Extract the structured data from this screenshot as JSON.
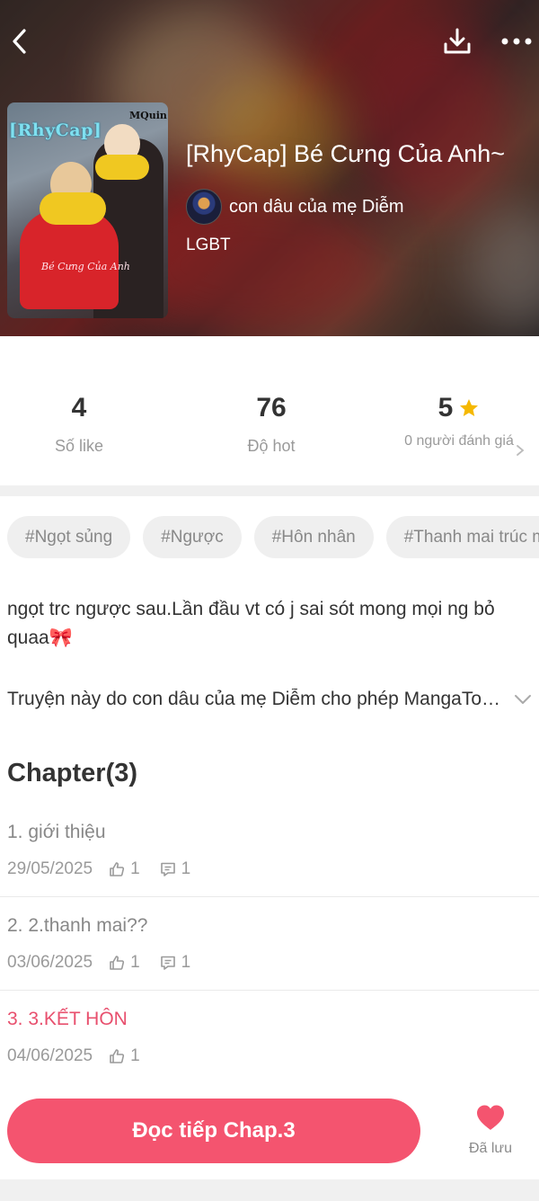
{
  "story": {
    "cover_title": "[RhyCap]",
    "cover_author_mark": "MQuin",
    "cover_subtitle": "Bé Cưng Của Anh",
    "title": "[RhyCap] Bé Cưng Của Anh~",
    "author": "con dâu của mẹ Diễm",
    "genre": "LGBT"
  },
  "stats": {
    "likes": "4",
    "likes_label": "Số like",
    "hot": "76",
    "hot_label": "Độ hot",
    "rating": "5",
    "rating_label": "0 người đánh giá"
  },
  "tags": [
    "#Ngọt sủng",
    "#Ngược",
    "#Hôn nhân",
    "#Thanh mai trúc mã"
  ],
  "description": "ngọt trc ngược sau.Lần đầu vt có j sai sót mong mọi ng bỏ quaa",
  "description_emoji": "🎀",
  "permission_text": "Truyện này do con dâu của mẹ Diễm cho phép MangaToon đăng tải",
  "chapters_heading": "Chapter(3)",
  "chapters": [
    {
      "title": "1. giới thiệu",
      "date": "29/05/2025",
      "likes": "1",
      "comments": "1"
    },
    {
      "title": "2. 2.thanh mai??",
      "date": "03/06/2025",
      "likes": "1",
      "comments": "1"
    },
    {
      "title": "3. 3.KẾT HÔN",
      "date": "04/06/2025",
      "likes": "1"
    }
  ],
  "bottom": {
    "read_button": "Đọc tiếp Chap.3",
    "saved_label": "Đã lưu"
  },
  "colors": {
    "accent": "#f4546f",
    "star": "#f5b800"
  }
}
